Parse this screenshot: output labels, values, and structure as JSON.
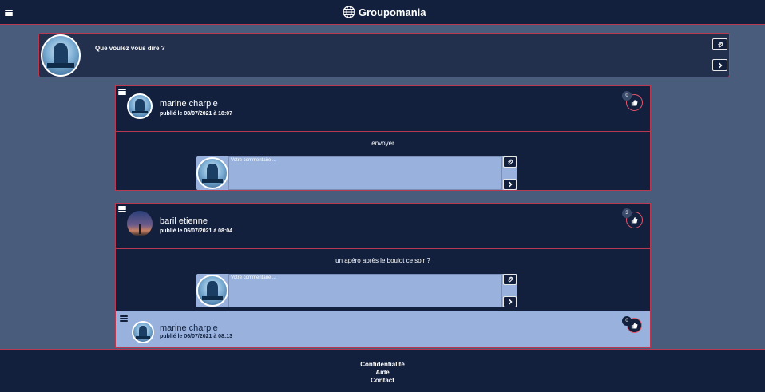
{
  "app": {
    "brand_name": "Groupomania",
    "brand_icon": "globe-icon"
  },
  "composer": {
    "prompt": "Que voulez vous dire ?",
    "attach_icon": "paperclip-icon",
    "send_icon": "chevron-right-icon"
  },
  "posts": [
    {
      "author": "marine charpie",
      "date": "publié le 08/07/2021 à 18:07",
      "likes": "0",
      "text": "envoyer",
      "comment_placeholder": "Votre commentaire ..."
    },
    {
      "author": "baril etienne",
      "date": "publié le 06/07/2021 à 08:04",
      "likes": "3",
      "text": "un apéro après le boulot ce soir ?",
      "comment_placeholder": "Votre commentaire ...",
      "comments": [
        {
          "author": "marine charpie",
          "date": "publié le 06/07/2021 à 08:13",
          "likes": "0"
        }
      ]
    }
  ],
  "footer": {
    "links": [
      "Confidentialité",
      "Aide",
      "Contact"
    ]
  },
  "colors": {
    "navy": "#12203d",
    "accent": "#b83a52",
    "page_bg": "#4a5c7c",
    "comment_bg": "#98b2dd"
  }
}
